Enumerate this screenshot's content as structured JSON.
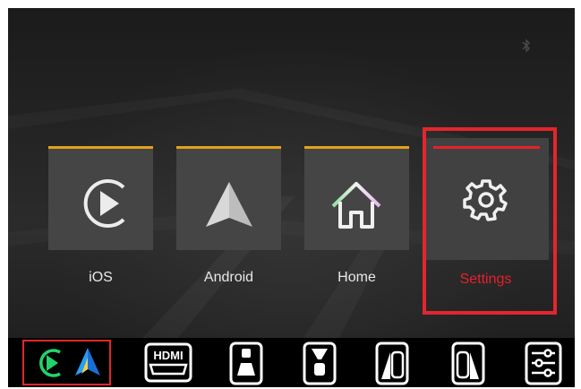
{
  "menu": {
    "items": [
      {
        "label": "iOS",
        "icon": "carplay-icon"
      },
      {
        "label": "Android",
        "icon": "android-auto-icon"
      },
      {
        "label": "Home",
        "icon": "home-icon"
      },
      {
        "label": "Settings",
        "icon": "gear-icon",
        "selected": true
      }
    ]
  },
  "status": {
    "bluetooth_icon": "bluetooth-icon"
  },
  "dock": {
    "items": [
      {
        "icon": "carplay-android-icon",
        "selected": true
      },
      {
        "icon": "hdmi-icon",
        "text": "HDMI"
      },
      {
        "icon": "front-camera-icon"
      },
      {
        "icon": "front-rear-camera-icon"
      },
      {
        "icon": "left-camera-icon"
      },
      {
        "icon": "right-camera-icon"
      },
      {
        "icon": "sliders-icon"
      }
    ]
  },
  "colors": {
    "accent_orange": "#e3a21a",
    "selected_red": "#e3262d",
    "tile_bg": "#454545",
    "label_text": "#e8e8e8",
    "dock_green": "#22d36a",
    "dock_blue": "#2a9df4"
  }
}
